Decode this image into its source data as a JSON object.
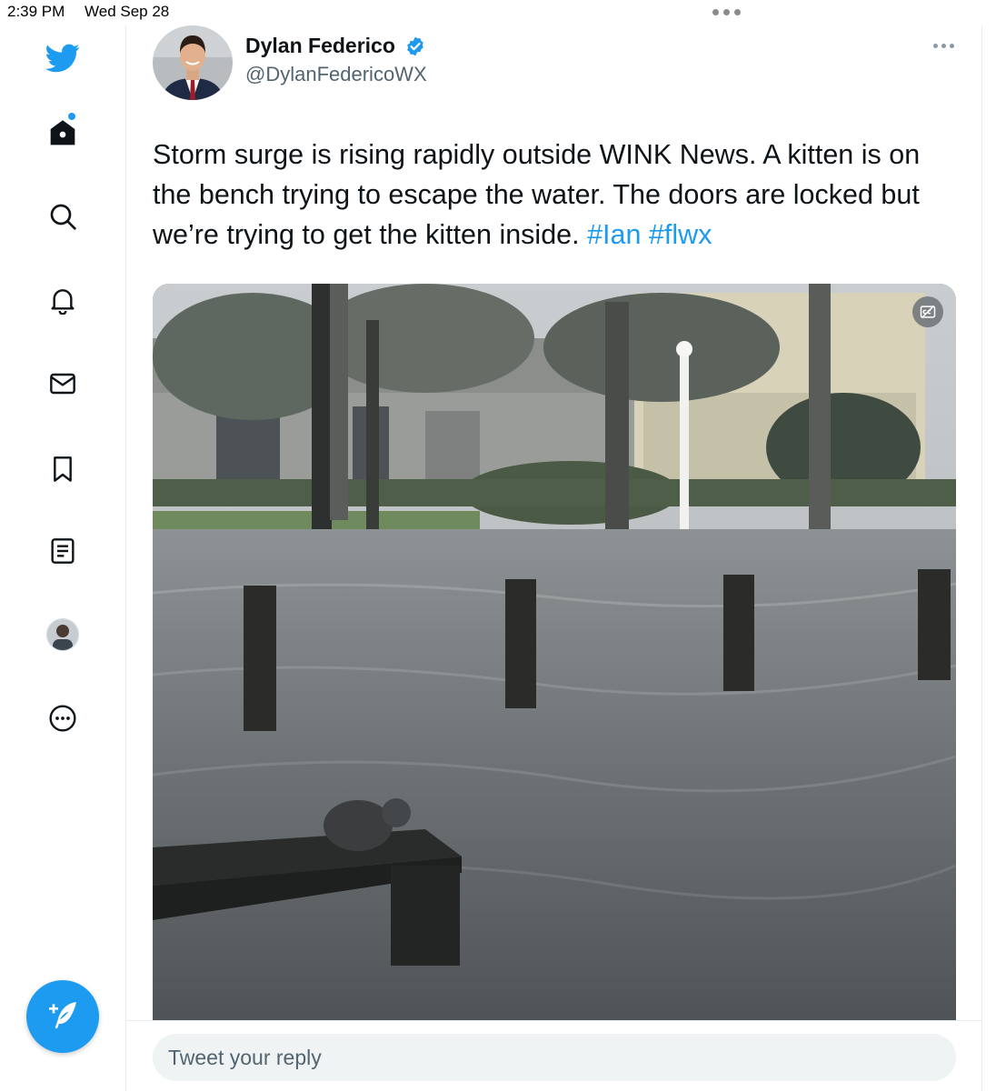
{
  "status_bar": {
    "time": "2:39 PM",
    "date": "Wed Sep 28"
  },
  "sidebar": {
    "items": [
      {
        "icon": "twitter-bird-icon"
      },
      {
        "icon": "home-icon",
        "has_notification_dot": true
      },
      {
        "icon": "search-icon"
      },
      {
        "icon": "bell-icon"
      },
      {
        "icon": "mail-icon"
      },
      {
        "icon": "bookmark-icon"
      },
      {
        "icon": "lists-icon"
      },
      {
        "icon": "profile-avatar"
      },
      {
        "icon": "more-circle-icon"
      }
    ],
    "compose_icon": "compose-feather-icon"
  },
  "tweet": {
    "author_name": "Dylan Federico",
    "author_handle": "@DylanFedericoWX",
    "verified": true,
    "text": "Storm surge is rising rapidly outside WINK News. A kitten is on the bench trying to escape the water. The doors are locked but we’re trying to get the kitten inside.",
    "hashtags": [
      "#Ian",
      "#flwx"
    ]
  },
  "reply": {
    "placeholder": "Tweet your reply"
  },
  "colors": {
    "accent": "#1d9bf0",
    "text": "#0f1419",
    "muted": "#536471"
  }
}
